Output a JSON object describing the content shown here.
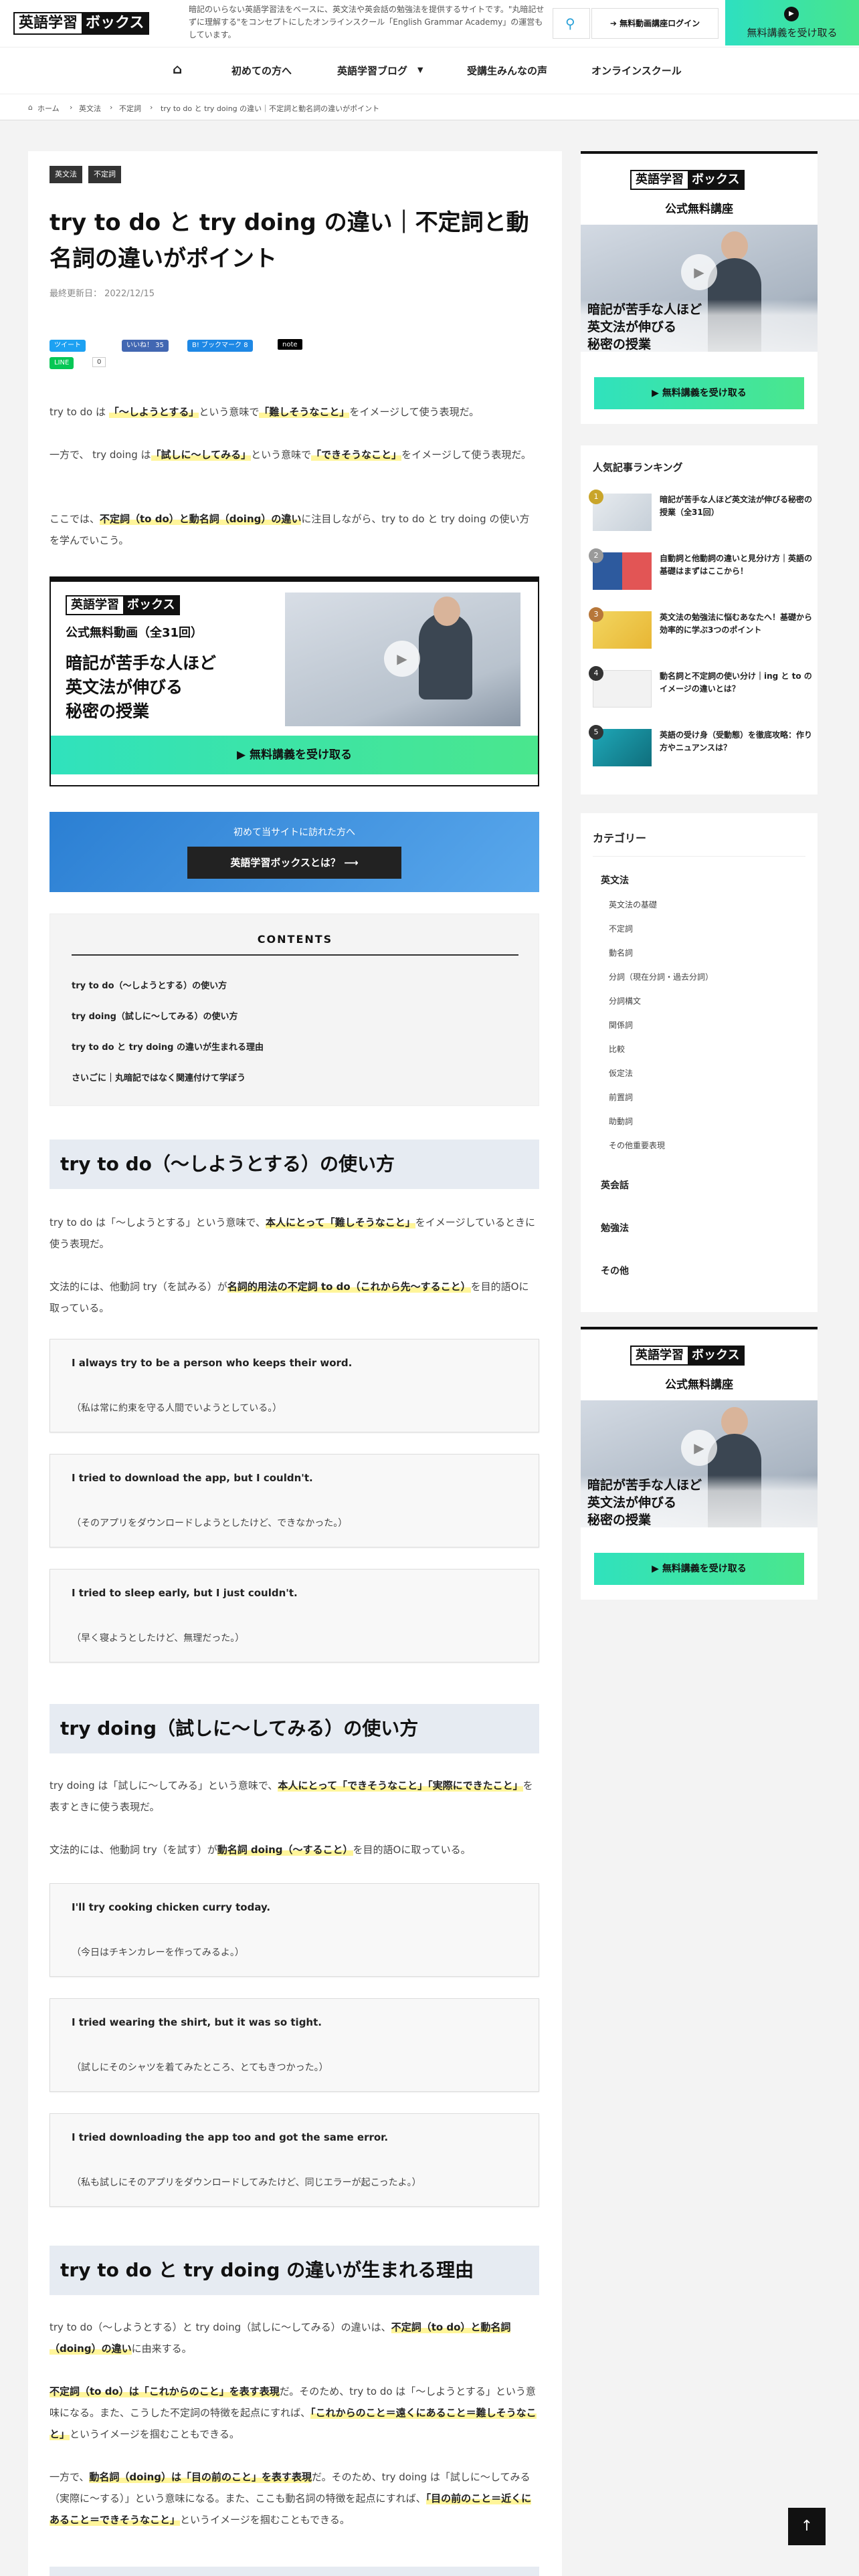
{
  "header": {
    "logo_left": "英語学習",
    "logo_right": "ボックス",
    "tagline": "暗記のいらない英語学習法をベースに、英文法や英会話の勉強法を提供するサイトです。\"丸暗記せずに理解する\"をコンセプトにしたオンラインスクール「English Grammar Academy」の運営もしています。",
    "login": "無料動画講座ログイン",
    "free": "無料講義を受け取る"
  },
  "nav": [
    "初めての方へ",
    "英語学習ブログ",
    "受講生みんなの声",
    "オンラインスクール"
  ],
  "breadcrumb": [
    "ホーム",
    "英文法",
    "不定詞",
    "try to do と try doing の違い｜不定詞と動名詞の違いがポイント"
  ],
  "article": {
    "tags": [
      "英文法",
      "不定詞"
    ],
    "title": "try to do と try doing の違い｜不定詞と動名詞の違いがポイント",
    "updated": "最終更新日： 2022/12/15",
    "share": {
      "tweet": "ツイート",
      "like": "いいね！ 35",
      "hatena": "B! ブックマーク 8",
      "note": "note",
      "line": "LINE",
      "line_count": "0"
    },
    "intro1": [
      "try to do は ",
      "「〜しようとする」",
      "という意味で",
      "「難しそうなこと」",
      "をイメージして使う表現だ。"
    ],
    "intro2": [
      "一方で、 try doing は",
      "「試しに〜してみる」",
      "という意味で",
      "「できそうなこと」",
      "をイメージして使う表現だ。"
    ],
    "intro3": [
      "ここでは、",
      "不定詞（to do）と動名詞（doing）の違い",
      "に注目しながら、try to do と try doing の使い方を学んでいこう。"
    ]
  },
  "banner": {
    "logo_left": "英語学習",
    "logo_right": "ボックス",
    "sub": "公式無料動画（全31回）",
    "line1": "暗記が苦手な人ほど",
    "line2": "英文法が伸びる",
    "line3": "秘密の授業",
    "button": "無料講義を受け取る"
  },
  "first_visit": {
    "text": "初めて当サイトに訪れた方へ",
    "button": "英語学習ボックスとは？"
  },
  "toc": {
    "title": "CONTENTS",
    "items": [
      "try to do（〜しようとする）の使い方",
      "try doing（試しに〜してみる）の使い方",
      "try to do と try doing の違いが生まれる理由",
      "さいごに｜丸暗記ではなく関連付けて学ぼう"
    ]
  },
  "section1": {
    "heading": "try to do（〜しようとする）の使い方",
    "p1": [
      "try to do は「〜しようとする」という意味で、",
      "本人にとって「難しそうなこと」",
      "をイメージしているときに使う表現だ。"
    ],
    "p2": [
      "文法的には、他動詞 try（を試みる）が",
      "名詞的用法の不定詞 to do（これから先〜すること）",
      "を目的語Oに取っている。"
    ],
    "examples": [
      {
        "en": "I always try to be a person who keeps their word.",
        "ja": "（私は常に約束を守る人間でいようとしている。）"
      },
      {
        "en": "I tried to download the app, but I couldn't.",
        "ja": "（そのアプリをダウンロードしようとしたけど、できなかった。）"
      },
      {
        "en": "I tried to sleep early, but I just couldn't.",
        "ja": "（早く寝ようとしたけど、無理だった。）"
      }
    ]
  },
  "section2": {
    "heading": "try doing（試しに〜してみる）の使い方",
    "p1": [
      "try doing は「試しに〜してみる」という意味で、",
      "本人にとって「できそうなこと」「実際にできたこと」",
      "を表すときに使う表現だ。"
    ],
    "p2": [
      "文法的には、他動詞 try（を試す）が",
      "動名詞 doing（〜すること）",
      "を目的語Oに取っている。"
    ],
    "examples": [
      {
        "en": "I'll try cooking chicken curry today.",
        "ja": "（今日はチキンカレーを作ってみるよ。）"
      },
      {
        "en": "I tried wearing the shirt, but it was so tight.",
        "ja": "（試しにそのシャツを着てみたところ、とてもきつかった。）"
      },
      {
        "en": "I tried downloading the app too and got the same error.",
        "ja": "（私も試しにそのアプリをダウンロードしてみたけど、同じエラーが起こったよ。）"
      }
    ]
  },
  "section3": {
    "heading": "try to do と try doing の違いが生まれる理由",
    "p1a": "try to do（〜しようとする）と try doing（試しに〜してみる）の違いは、",
    "p1b": "不定詞（to do）と動名詞（doing）の違い",
    "p1c": "に由来する。",
    "p2a": "不定詞（to do）は「これからのこと」を表す表現",
    "p2b": "だ。そのため、try to do は「〜しようとする」という意味になる。また、こうした不定詞の特徴を起点にすれば、",
    "p2c": "「これからのこと＝遠くにあること＝難しそうなこと」",
    "p2d": "というイメージを掴むこともできる。",
    "p3a": "一方で、",
    "p3b": "動名詞（doing）は「目の前のこと」を表す表現",
    "p3c": "だ。そのため、try doing は「試しに〜してみる（実際に〜する）」という意味になる。また、ここも動名詞の特徴を起点にすれば、",
    "p3d": "「目の前のこと＝近くにあること＝できそうなこと」",
    "p3e": "というイメージを掴むこともできる。"
  },
  "sidebar": {
    "promo": {
      "logo_left": "英語学習",
      "logo_right": "ボックス",
      "sub": "公式無料講座",
      "caption1": "暗記が苦手な人ほど",
      "caption2": "英文法が伸びる",
      "caption3": "秘密の授業",
      "button": "無料講義を受け取る"
    },
    "ranking_title": "人気記事ランキング",
    "ranking": [
      {
        "num": "1",
        "title": "暗記が苦手な人ほど英文法が伸びる秘密の授業（全31回）",
        "color": "#c9a52a"
      },
      {
        "num": "2",
        "title": "自動詞と他動詞の違いと見分け方｜英語の基礎はまずはここから！",
        "color": "#9a9a9a"
      },
      {
        "num": "3",
        "title": "英文法の勉強法に悩むあなたへ！基礎から効率的に学ぶ3つのポイント",
        "color": "#b7773a"
      },
      {
        "num": "4",
        "title": "動名詞と不定詞の使い分け｜ing と to のイメージの違いとは？",
        "color": "#333333"
      },
      {
        "num": "5",
        "title": "英語の受け身（受動態）を徹底攻略：作り方やニュアンスは？",
        "color": "#333333"
      }
    ],
    "category_title": "カテゴリー",
    "categories_main": "英文法",
    "categories_sub": [
      "英文法の基礎",
      "不定詞",
      "動名詞",
      "分詞（現在分詞・過去分詞）",
      "分詞構文",
      "関係詞",
      "比較",
      "仮定法",
      "前置詞",
      "助動詞",
      "その他重要表現"
    ],
    "categories_other": [
      "英会話",
      "勉強法",
      "その他"
    ]
  },
  "colors": {
    "accent": "#2aa1d8",
    "green": "#45e595",
    "highlight": "#fff59a",
    "heading_bg": "#e6ebf2"
  }
}
